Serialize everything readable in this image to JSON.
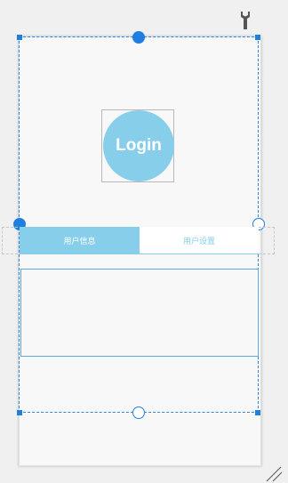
{
  "toolbar": {
    "settings_icon": "wrench-icon"
  },
  "login": {
    "label": "Login",
    "color": "#87ceeb"
  },
  "tabs": [
    {
      "label": "用户信息",
      "active": true
    },
    {
      "label": "用户设置",
      "active": false
    }
  ],
  "colors": {
    "selection": "#1e7fe0",
    "accent": "#87ceeb"
  }
}
